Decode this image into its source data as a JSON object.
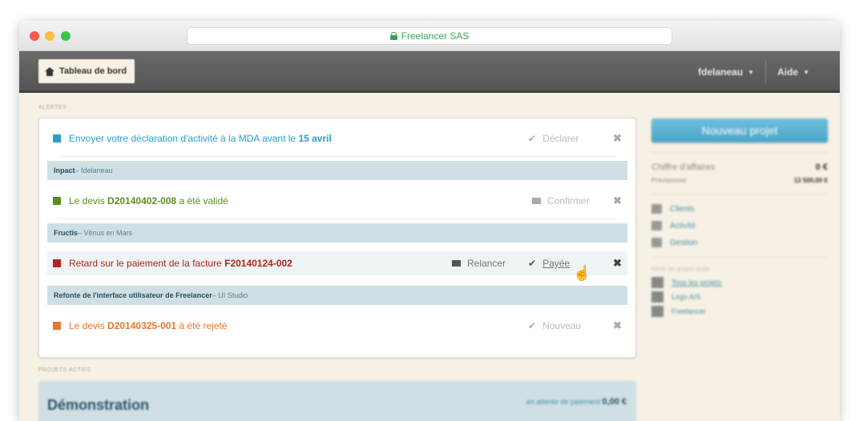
{
  "browser": {
    "url": "Freelancer SAS"
  },
  "nav": {
    "brand": "Tableau de bord",
    "user": "fdelaneau",
    "help": "Aide"
  },
  "alerts_label": "Alertes",
  "alerts": [
    {
      "parts": [
        "Envoyer votre déclaration d'activité à la MDA avant le ",
        "15 avril",
        ""
      ],
      "color": "#2a9fc9",
      "action": "Déclarer",
      "action_icon": "check-icon"
    },
    {
      "parts": [
        "Le devis ",
        "D20140402-008",
        " a été validé"
      ],
      "color": "#5a8f1e",
      "action": "Confirmer",
      "action_icon": "mail-icon"
    },
    {
      "parts": [
        "Retard sur le paiement de la facture ",
        "F20140124-002",
        ""
      ],
      "color": "#b0251c",
      "action": "Payée",
      "action_icon": "check-icon",
      "extra_action": "Relancer"
    },
    {
      "parts": [
        "Le devis ",
        "D20140325-001",
        " à été rejeté"
      ],
      "color": "#e5772c",
      "action": "Nouveau",
      "action_icon": "check-icon"
    }
  ],
  "groups": [
    {
      "title": "Inpact",
      "sub": " – fdelaneau"
    },
    {
      "title": "Fructis",
      "sub": " – Vénus en Mars"
    },
    {
      "title": "Refonte de l'interface utilisateur de Freelancer",
      "sub": " – UI Studio"
    }
  ],
  "sidebar": {
    "new_project": "Nouveau projet",
    "ca_label": "Chiffre d'affaires",
    "ca_value": "0 €",
    "prev_label": "Prévisionnel",
    "prev_value": "13 500,00 €",
    "links": [
      "Clients",
      "Activité",
      "Gestion"
    ],
    "filter_title": "Filtrer les projets actifs",
    "filters": [
      "Tous les projets",
      "Logo A/S",
      "Freelancer"
    ]
  },
  "projects_label": "Projets actifs",
  "project": {
    "title": "Démonstration",
    "status": "en attente de paiement",
    "amount": "0,00 €"
  }
}
